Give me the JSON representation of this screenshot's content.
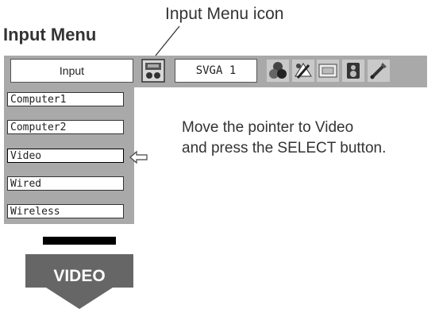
{
  "callout": "Input Menu icon",
  "title": "Input Menu",
  "menubar": {
    "input_label": "Input",
    "mode_label": "SVGA 1",
    "icons": [
      "input-icon",
      "color-icon",
      "image-adjust-icon",
      "screen-icon",
      "sound-icon",
      "setting-icon"
    ]
  },
  "submenu": {
    "items": [
      "Computer1",
      "Computer2",
      "Video",
      "Wired",
      "Wireless"
    ],
    "selected": "Video"
  },
  "instructions": {
    "line1": "Move the pointer to Video",
    "line2": "and press the SELECT button."
  },
  "arrow_label": "VIDEO",
  "colors": {
    "menu_bg": "#a9a9a9",
    "arrow": "#666666",
    "icon_dark": "#4a4a4a"
  }
}
